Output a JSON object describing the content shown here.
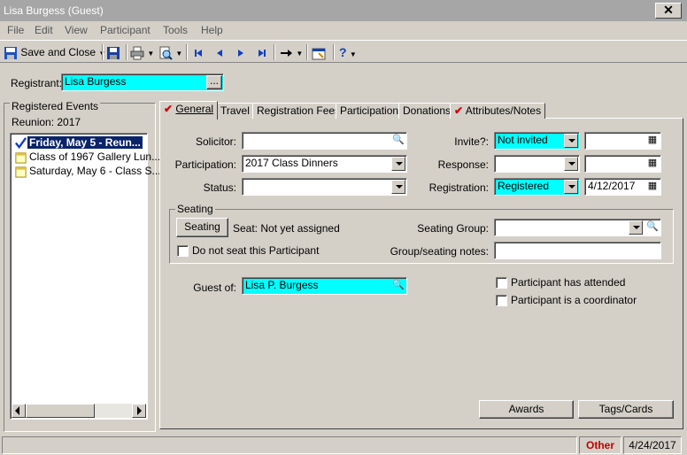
{
  "window": {
    "title": "Lisa Burgess (Guest)",
    "close_glyph": "✕"
  },
  "menu": [
    "File",
    "Edit",
    "View",
    "Participant",
    "Tools",
    "Help"
  ],
  "toolbar": {
    "save_close": "Save and Close",
    "help_glyph": "?"
  },
  "registrant": {
    "label": "Registrant:",
    "value": "Lisa Burgess",
    "browse": "..."
  },
  "left": {
    "title": "Registered Events",
    "event_name": "Reunion: 2017",
    "items": [
      "Friday, May 5 - Reun...",
      "Class of 1967 Gallery Lun...",
      "Saturday, May 6 - Class S..."
    ]
  },
  "tabs": [
    "General",
    "Travel",
    "Registration Fees",
    "Participation",
    "Donations",
    "Attributes/Notes"
  ],
  "general": {
    "solicitor_label": "Solicitor:",
    "solicitor_value": "",
    "participation_label": "Participation:",
    "participation_value": "2017 Class Dinners",
    "status_label": "Status:",
    "status_value": "",
    "invite_label": "Invite?:",
    "invite_value": "Not invited",
    "invite_date": "",
    "response_label": "Response:",
    "response_value": "",
    "response_date": "",
    "registration_label": "Registration:",
    "registration_value": "Registered",
    "registration_date": "4/12/2017",
    "seating_group_title": "Seating",
    "seating_button": "Seating",
    "seat_text": "Seat: Not yet assigned",
    "do_not_seat": "Do not seat this Participant",
    "seating_group_label": "Seating Group:",
    "seating_group_value": "",
    "group_notes_label": "Group/seating notes:",
    "group_notes_value": "",
    "guest_of_label": "Guest of:",
    "guest_of_value": "Lisa P. Burgess",
    "attended": "Participant has attended",
    "coordinator": "Participant is a coordinator",
    "awards_button": "Awards",
    "tags_button": "Tags/Cards"
  },
  "status": {
    "other": "Other",
    "date": "4/24/2017"
  },
  "colors": {
    "highlight": "#00ffff",
    "selection": "#0a246a",
    "other_text": "#c00000"
  }
}
